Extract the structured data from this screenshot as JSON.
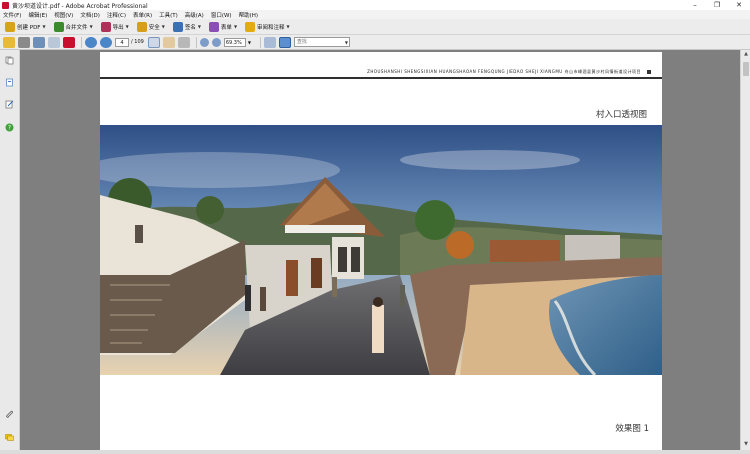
{
  "window": {
    "title": "黄沙坝道设计.pdf - Adobe Acrobat Professional",
    "controls": [
      "–",
      "❐",
      "✕"
    ]
  },
  "menubar": [
    "文件(F)",
    "编辑(E)",
    "视图(V)",
    "文档(D)",
    "注释(C)",
    "表单(R)",
    "工具(T)",
    "高级(A)",
    "窗口(W)",
    "帮助(H)"
  ],
  "toolbar": {
    "buttons": [
      {
        "label": "创建 PDF",
        "icon": "create-pdf-icon",
        "color": "#d9a21c"
      },
      {
        "label": "合并文件",
        "icon": "combine-files-icon",
        "color": "#3c8a2d"
      },
      {
        "label": "导出",
        "icon": "export-icon",
        "color": "#b0305a"
      },
      {
        "label": "安全",
        "icon": "lock-icon",
        "color": "#d4a017"
      },
      {
        "label": "签名",
        "icon": "pen-icon",
        "color": "#3b6fb6"
      },
      {
        "label": "表单",
        "icon": "form-icon",
        "color": "#8a4fb0"
      },
      {
        "label": "审阅和注释",
        "icon": "comment-icon",
        "color": "#e5a913"
      }
    ]
  },
  "navbar": {
    "current_page": "4",
    "page_count": "/ 109",
    "zoom": "69.3%",
    "find_placeholder": "查找"
  },
  "document": {
    "header": "ZHOUSHANSHI SHENGSIXIAN HUANGSHAOAN FENGQUNG JIEDAO SHEJI XIANGMU 舟山市嵊泗县黄沙村风情街道设计项目",
    "view_title": "村入口透视图",
    "caption": "效果图 1"
  },
  "colors": {
    "doc_background": "#7f7f7f",
    "page": "#ffffff",
    "header_rule": "#2f2f2f"
  }
}
